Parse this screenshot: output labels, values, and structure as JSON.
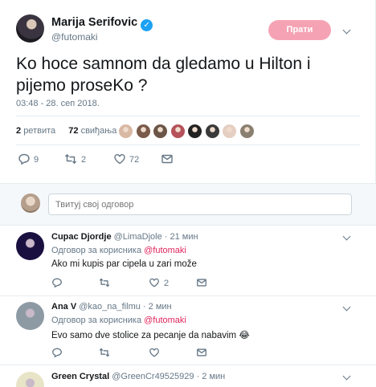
{
  "main_tweet": {
    "author_name": "Marija Serifovic",
    "verified_mark": "✓",
    "handle": "@futomaki",
    "follow_label": "Прати",
    "text": "Ko hoce samnom da gledamo u Hilton i pijemo proseKo ?",
    "timestamp": "03:48 - 28. сеп 2018.",
    "retweets_count": "2",
    "retweets_label": "ретвита",
    "likes_count": "72",
    "likes_label": "свиђања",
    "liker_avatars": [
      "#d9b8a4",
      "#7a5a4a",
      "#6b5547",
      "#b5525a",
      "#222222",
      "#3a3a3a",
      "#e5cfc2",
      "#8a8070"
    ],
    "actions": {
      "reply_count": "9",
      "retweet_count": "2",
      "like_count": "72"
    }
  },
  "reply_box": {
    "placeholder": "Твитуј свој одговор"
  },
  "replies": [
    {
      "name": "Cupac Djordje",
      "handle": "@LimaDjole",
      "time": "· 21 мин",
      "reply_to_prefix": "Одговор за корисника",
      "reply_to_handle": "@futomaki",
      "text": "Ako mi kupis par cipela u zari može",
      "reply_count": "",
      "retweet_count": "",
      "like_count": "2",
      "avatar_color": "#1a1040"
    },
    {
      "name": "Ana V",
      "handle": "@kao_na_filmu",
      "time": "· 2 мин",
      "reply_to_prefix": "Одговор за корисника",
      "reply_to_handle": "@futomaki",
      "text": "Evo samo dve stolice za pecanje da nabavim 😂",
      "reply_count": "",
      "retweet_count": "",
      "like_count": "",
      "avatar_color": "#8d9aa3"
    },
    {
      "name": "Green Crystal",
      "handle": "@GreenCr49525929",
      "time": "· 2 мин",
      "avatar_color": "#e8e4c8"
    }
  ],
  "colors": {
    "follow_button": "#f5a3b4",
    "mention": "#e0245e",
    "verified": "#1da1f2",
    "muted_text": "#657786",
    "divider": "#e6ecf0"
  }
}
